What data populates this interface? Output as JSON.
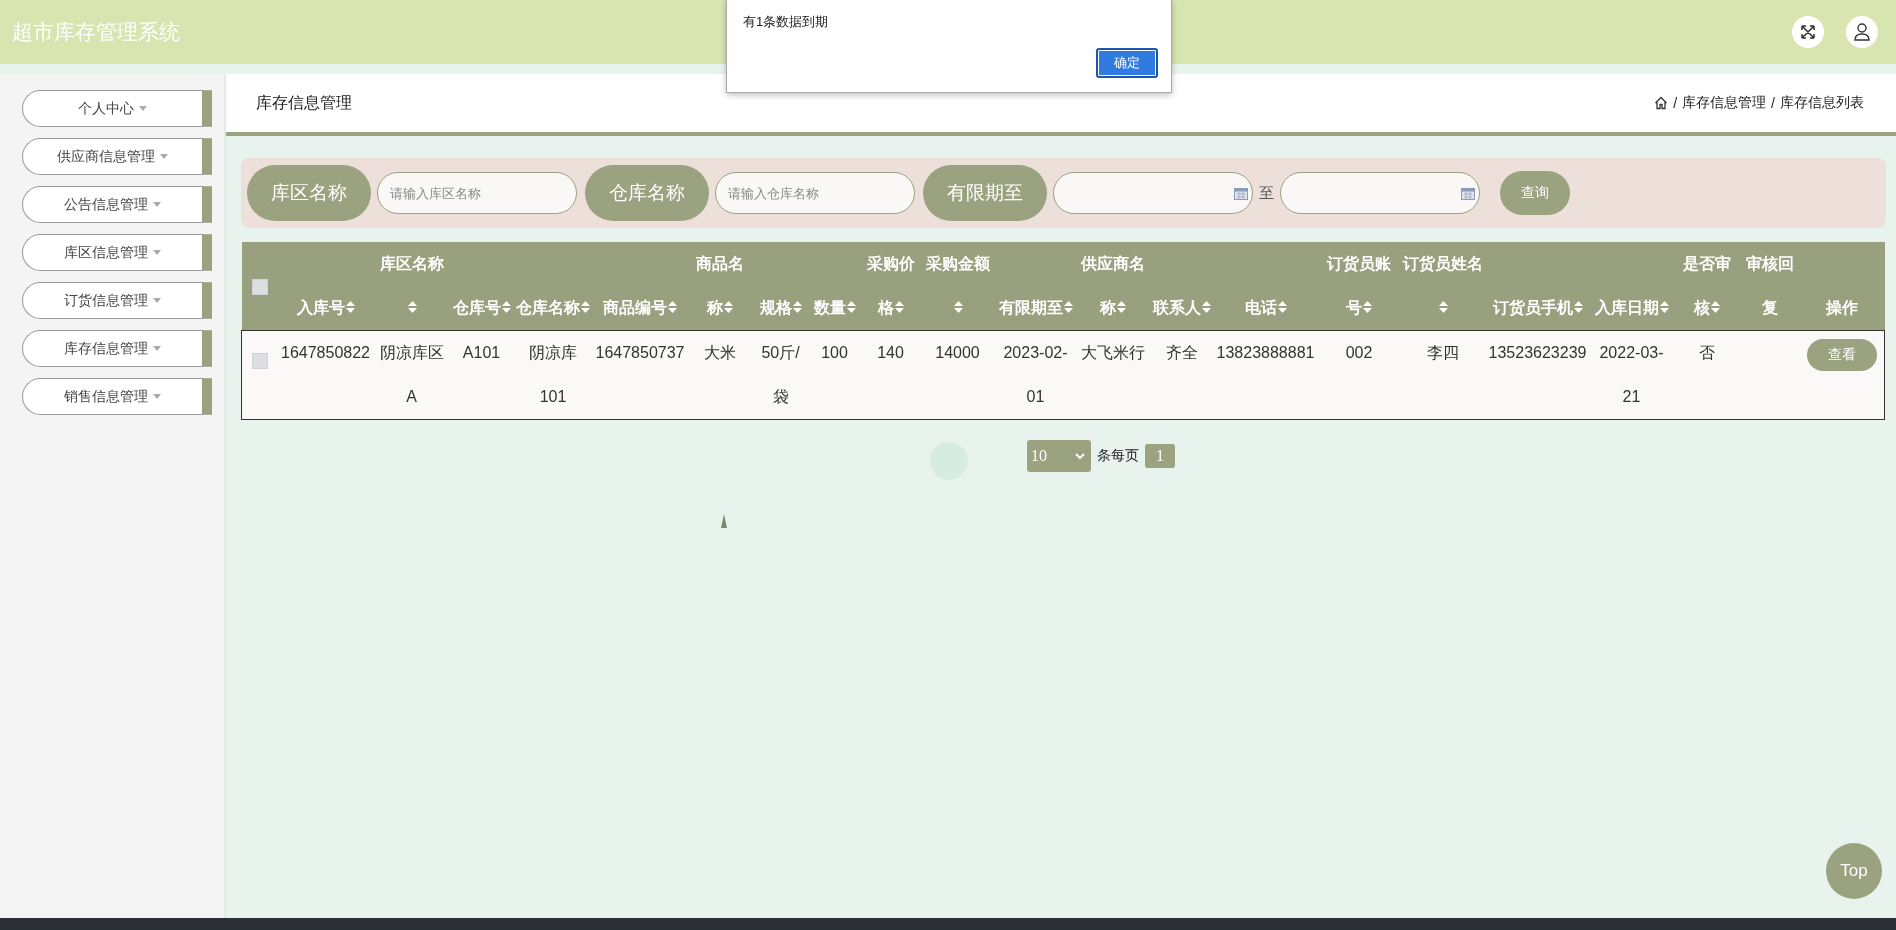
{
  "app": {
    "title": "超市库存管理系统"
  },
  "alert": {
    "message": "有1条数据到期",
    "button": "确定"
  },
  "sidebar": {
    "items": [
      {
        "label": "个人中心"
      },
      {
        "label": "供应商信息管理"
      },
      {
        "label": "公告信息管理"
      },
      {
        "label": "库区信息管理"
      },
      {
        "label": "订货信息管理"
      },
      {
        "label": "库存信息管理"
      },
      {
        "label": "销售信息管理"
      }
    ]
  },
  "page": {
    "title": "库存信息管理",
    "breadcrumb": [
      "库存信息管理",
      "库存信息列表"
    ],
    "breadcrumb_separator": "/"
  },
  "search": {
    "fields": [
      {
        "kind": "text",
        "label": "库区名称",
        "placeholder": "请输入库区名称"
      },
      {
        "kind": "text",
        "label": "仓库名称",
        "placeholder": "请输入仓库名称"
      },
      {
        "kind": "daterange",
        "label": "有限期至",
        "separator": "至"
      }
    ],
    "button": "查询"
  },
  "table": {
    "select_all": false,
    "columns": [
      {
        "label": "入库号",
        "sortable": true
      },
      {
        "label": "库区名称",
        "sortable": true
      },
      {
        "label": "仓库号",
        "sortable": true
      },
      {
        "label": "仓库名称",
        "sortable": true
      },
      {
        "label": "商品编号",
        "sortable": true
      },
      {
        "label": "商品名称",
        "sortable": true
      },
      {
        "label": "规格",
        "sortable": true
      },
      {
        "label": "数量",
        "sortable": true
      },
      {
        "label": "采购价格",
        "sortable": true
      },
      {
        "label": "采购金额",
        "sortable": true
      },
      {
        "label": "有限期至",
        "sortable": true
      },
      {
        "label": "供应商名称",
        "sortable": true
      },
      {
        "label": "联系人",
        "sortable": true
      },
      {
        "label": "电话",
        "sortable": true
      },
      {
        "label": "订货员账号",
        "sortable": true
      },
      {
        "label": "订货员姓名",
        "sortable": true
      },
      {
        "label": "订货员手机",
        "sortable": true
      },
      {
        "label": "入库日期",
        "sortable": true
      },
      {
        "label": "是否审核",
        "sortable": true
      },
      {
        "label": "审核回复",
        "sortable": false
      },
      {
        "label": "操作",
        "sortable": false
      }
    ],
    "rows": [
      {
        "selected": false,
        "cells": [
          "1647850822",
          "阴凉库区A",
          "A101",
          "阴凉库101",
          "1647850737",
          "大米",
          "50斤/袋",
          "100",
          "140",
          "14000",
          "2023-02-01",
          "大飞米行",
          "齐全",
          "13823888881",
          "002",
          "李四",
          "13523623239",
          "2022-03-21",
          "否",
          null
        ],
        "action": "查看"
      }
    ]
  },
  "pagination": {
    "page_size": "10",
    "page_size_label": "条每页",
    "pages": [
      {
        "label": "1",
        "selected": true
      }
    ]
  },
  "back_to_top": "Top"
}
